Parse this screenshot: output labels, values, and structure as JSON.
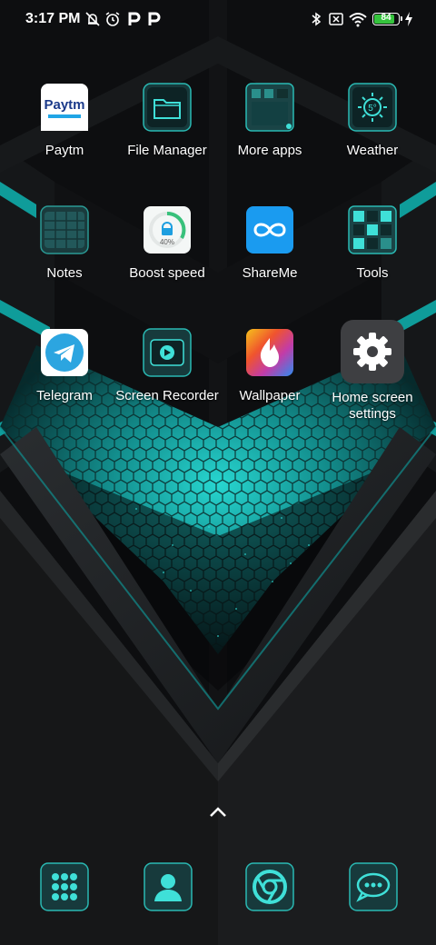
{
  "status_bar": {
    "time": "3:17 PM",
    "left_icons": [
      "muted-bell-icon",
      "alarm-icon",
      "paytm-p-icon",
      "paytm-p-icon"
    ],
    "right_icons": [
      "bluetooth-icon",
      "no-sim-icon",
      "wifi-icon",
      "battery-icon",
      "charging-icon"
    ],
    "battery_level": 84,
    "battery_label": "84"
  },
  "apps": [
    {
      "label": "Paytm",
      "icon": "paytm-logo"
    },
    {
      "label": "File Manager",
      "icon": "folder-icon"
    },
    {
      "label": "More apps",
      "icon": "more-apps-icon"
    },
    {
      "label": "Weather",
      "icon": "weather-sun-icon",
      "badge": "5°"
    },
    {
      "label": "Notes",
      "icon": "notes-icon"
    },
    {
      "label": "Boost speed",
      "icon": "boost-speed-icon",
      "badge": "40%"
    },
    {
      "label": "ShareMe",
      "icon": "infinity-icon"
    },
    {
      "label": "Tools",
      "icon": "tools-icon"
    },
    {
      "label": "Telegram",
      "icon": "telegram-plane-icon"
    },
    {
      "label": "Screen Recorder",
      "icon": "screen-recorder-icon"
    },
    {
      "label": "Wallpaper",
      "icon": "wallpaper-flame-icon"
    },
    {
      "label": "Home screen settings",
      "icon": "gear-icon"
    }
  ],
  "dock": [
    "dialer-icon",
    "contacts-icon",
    "chrome-icon",
    "messages-icon"
  ],
  "colors": {
    "accent": "#1fb5b0",
    "wallpaper_dark": "#0b0c0d",
    "battery": "#35c43d"
  }
}
